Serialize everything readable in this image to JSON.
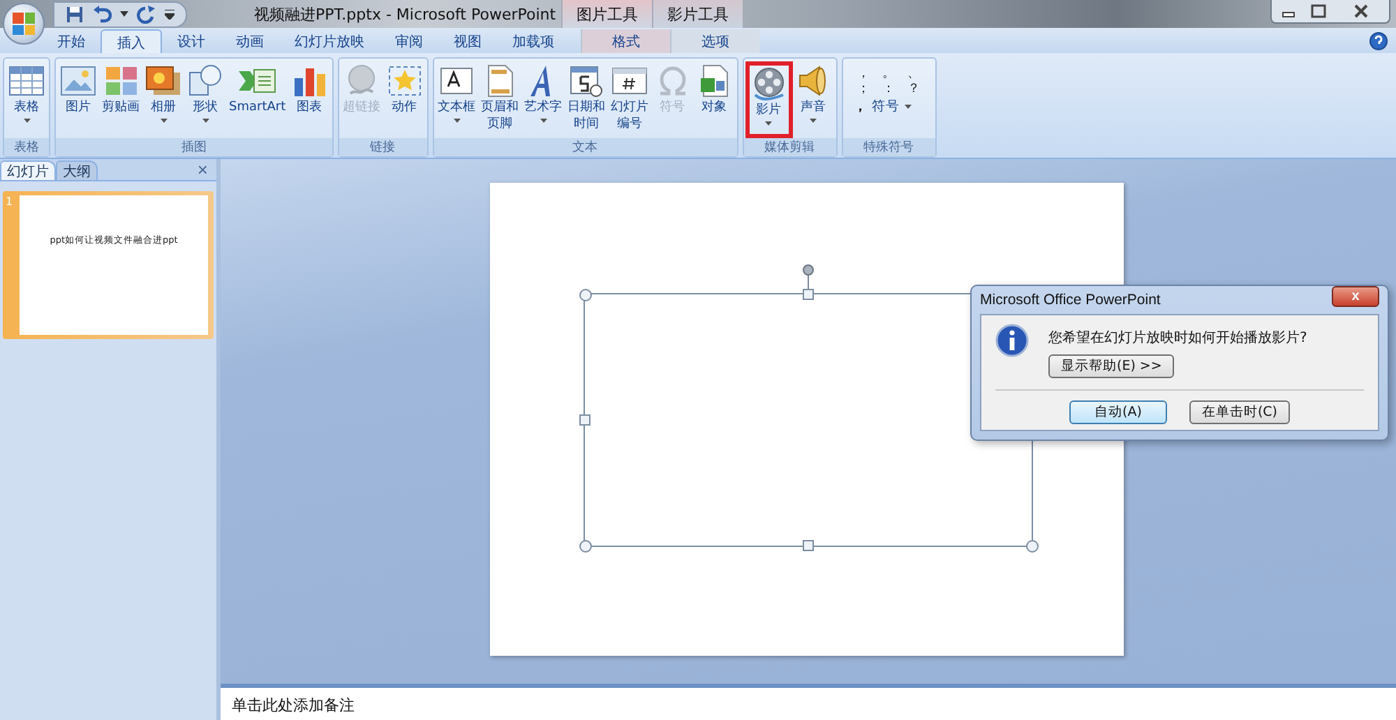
{
  "window": {
    "title": "视频融进PPT.pptx - Microsoft PowerPoint",
    "context_tools": [
      {
        "header": "图片工具",
        "tab": "格式",
        "selected": false
      },
      {
        "header": "影片工具",
        "tab": "选项",
        "selected": false
      }
    ]
  },
  "tabs": [
    {
      "label": "开始",
      "selected": false
    },
    {
      "label": "插入",
      "selected": true
    },
    {
      "label": "设计",
      "selected": false
    },
    {
      "label": "动画",
      "selected": false
    },
    {
      "label": "幻灯片放映",
      "selected": false
    },
    {
      "label": "审阅",
      "selected": false
    },
    {
      "label": "视图",
      "selected": false
    },
    {
      "label": "加载项",
      "selected": false
    }
  ],
  "ribbon_groups": [
    {
      "name": "表格",
      "buttons": [
        {
          "label": [
            "表格"
          ],
          "dropdown": true,
          "disabled": false,
          "highlighted": false
        }
      ]
    },
    {
      "name": "插图",
      "buttons": [
        {
          "label": [
            "图片"
          ],
          "dropdown": false,
          "disabled": false,
          "highlighted": false
        },
        {
          "label": [
            "剪贴画"
          ],
          "dropdown": false,
          "disabled": false,
          "highlighted": false
        },
        {
          "label": [
            "相册"
          ],
          "dropdown": true,
          "disabled": false,
          "highlighted": false
        },
        {
          "label": [
            "形状"
          ],
          "dropdown": true,
          "disabled": false,
          "highlighted": false
        },
        {
          "label": [
            "SmartArt"
          ],
          "dropdown": false,
          "disabled": false,
          "highlighted": false
        },
        {
          "label": [
            "图表"
          ],
          "dropdown": false,
          "disabled": false,
          "highlighted": false
        }
      ]
    },
    {
      "name": "链接",
      "buttons": [
        {
          "label": [
            "超链接"
          ],
          "dropdown": false,
          "disabled": true,
          "highlighted": false
        },
        {
          "label": [
            "动作"
          ],
          "dropdown": false,
          "disabled": false,
          "highlighted": false
        }
      ]
    },
    {
      "name": "文本",
      "buttons": [
        {
          "label": [
            "文本框"
          ],
          "dropdown": true,
          "disabled": false,
          "highlighted": false
        },
        {
          "label": [
            "页眉和",
            "页脚"
          ],
          "dropdown": false,
          "disabled": false,
          "highlighted": false
        },
        {
          "label": [
            "艺术字"
          ],
          "dropdown": true,
          "disabled": false,
          "highlighted": false
        },
        {
          "label": [
            "日期和",
            "时间"
          ],
          "dropdown": false,
          "disabled": false,
          "highlighted": false
        },
        {
          "label": [
            "幻灯片",
            "编号"
          ],
          "dropdown": false,
          "disabled": false,
          "highlighted": false
        },
        {
          "label": [
            "符号"
          ],
          "dropdown": false,
          "disabled": true,
          "highlighted": false
        },
        {
          "label": [
            "对象"
          ],
          "dropdown": false,
          "disabled": false,
          "highlighted": false
        }
      ]
    },
    {
      "name": "媒体剪辑",
      "buttons": [
        {
          "label": [
            "影片"
          ],
          "dropdown": true,
          "disabled": false,
          "highlighted": true
        },
        {
          "label": [
            "声音"
          ],
          "dropdown": true,
          "disabled": false,
          "highlighted": false
        }
      ]
    }
  ],
  "special_symbols": {
    "name": "特殊符号",
    "symbols": [
      "，",
      "。",
      "、",
      "；",
      "：",
      "？"
    ],
    "button": {
      "mark": "，",
      "label": "符号"
    }
  },
  "slide_panel": {
    "tabs": [
      {
        "label": "幻灯片",
        "selected": true
      },
      {
        "label": "大纲",
        "selected": false
      }
    ],
    "close": "×",
    "slides": [
      {
        "number": "1",
        "title": "ppt如何让视频文件融合进ppt",
        "selected": true
      }
    ]
  },
  "dialog": {
    "title": "Microsoft Office PowerPoint",
    "close": "x",
    "message": "您希望在幻灯片放映时如何开始播放影片?",
    "help_button": "显示帮助(E) >>",
    "buttons": [
      {
        "label": "自动(A)",
        "default": true
      },
      {
        "label": "在单击时(C)",
        "default": false
      }
    ]
  },
  "notes": {
    "placeholder": "单击此处添加备注"
  }
}
